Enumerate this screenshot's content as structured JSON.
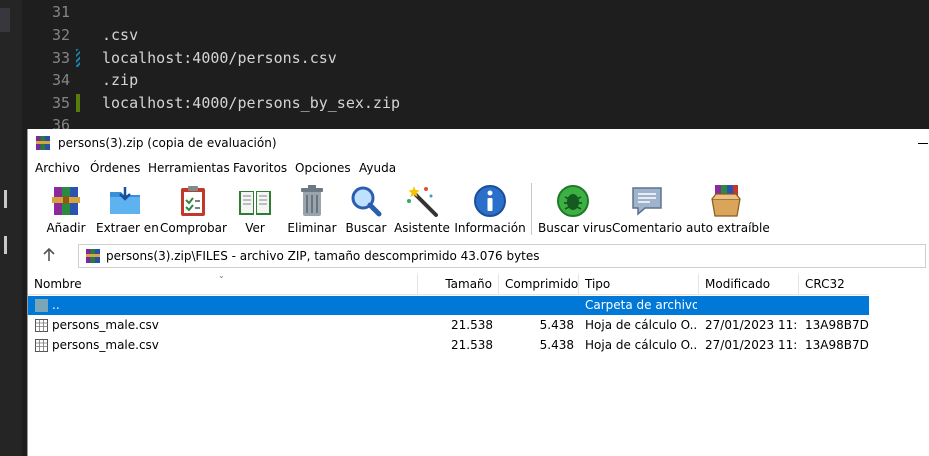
{
  "editor": {
    "lines": [
      {
        "num": "31",
        "text": ""
      },
      {
        "num": "32",
        "text": ".csv"
      },
      {
        "num": "33",
        "text": "localhost:4000/persons.csv"
      },
      {
        "num": "34",
        "text": ".zip"
      },
      {
        "num": "35",
        "text": "localhost:4000/persons_by_sex.zip"
      },
      {
        "num": "36",
        "text": ""
      }
    ]
  },
  "window": {
    "title": "persons(3).zip (copia de evaluación)"
  },
  "menu": [
    "Archivo",
    "Órdenes",
    "Herramientas",
    "Favoritos",
    "Opciones",
    "Ayuda"
  ],
  "toolbar": {
    "add": "Añadir",
    "extract": "Extraer en",
    "test": "Comprobar",
    "view": "Ver",
    "delete": "Eliminar",
    "find": "Buscar",
    "wizard": "Asistente",
    "info": "Información",
    "virus": "Buscar virus",
    "comment": "Comentario",
    "sfx": "auto extraíble"
  },
  "address": {
    "text": "persons(3).zip\\FILES - archivo ZIP, tamaño descomprimido 43.076 bytes"
  },
  "columns": {
    "name": "Nombre",
    "size": "Tamaño",
    "packed": "Comprimido",
    "type": "Tipo",
    "modified": "Modificado",
    "crc": "CRC32"
  },
  "files": [
    {
      "name": "..",
      "size": "",
      "packed": "",
      "type": "Carpeta de archivos",
      "modified": "",
      "crc": "",
      "selected": true
    },
    {
      "name": "persons_male.csv",
      "size": "21.538",
      "packed": "5.438",
      "type": "Hoja de cálculo O...",
      "modified": "27/01/2023 11:...",
      "crc": "13A98B7D",
      "selected": false
    },
    {
      "name": "persons_male.csv",
      "size": "21.538",
      "packed": "5.438",
      "type": "Hoja de cálculo O...",
      "modified": "27/01/2023 11:...",
      "crc": "13A98B7D",
      "selected": false
    }
  ],
  "colors": {
    "selection": "#0078d7",
    "editor_bg": "#1e1e1e"
  }
}
